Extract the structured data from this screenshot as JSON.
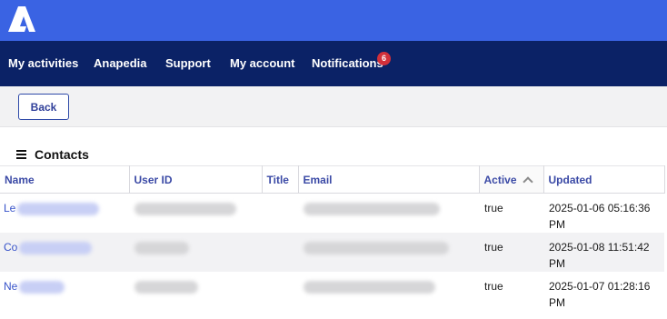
{
  "header": {
    "logo_icon": "anaplan-a-logo-icon",
    "brand_color": "#3a63e3"
  },
  "nav": {
    "items": [
      {
        "label": "My activities"
      },
      {
        "label": "Anapedia"
      },
      {
        "label": "Support"
      },
      {
        "label": "My account"
      },
      {
        "label": "Notifications"
      }
    ],
    "notifications_badge": "6",
    "background_color": "#0b2266"
  },
  "toolbar": {
    "back_label": "Back"
  },
  "section": {
    "title": "Contacts",
    "icon": "hamburger-menu-icon"
  },
  "table": {
    "columns": [
      "Name",
      "User ID",
      "Title",
      "Email",
      "Active",
      "Updated"
    ],
    "sorted_column": "Active",
    "sort_direction": "ascending",
    "rows": [
      {
        "name": "Le",
        "active": "true",
        "updated": "2025-01-06 05:16:36 PM"
      },
      {
        "name": "Co",
        "active": "true",
        "updated": "2025-01-08 11:51:42 PM"
      },
      {
        "name": "Ne",
        "active": "true",
        "updated": "2025-01-07 01:28:16 PM"
      }
    ]
  }
}
